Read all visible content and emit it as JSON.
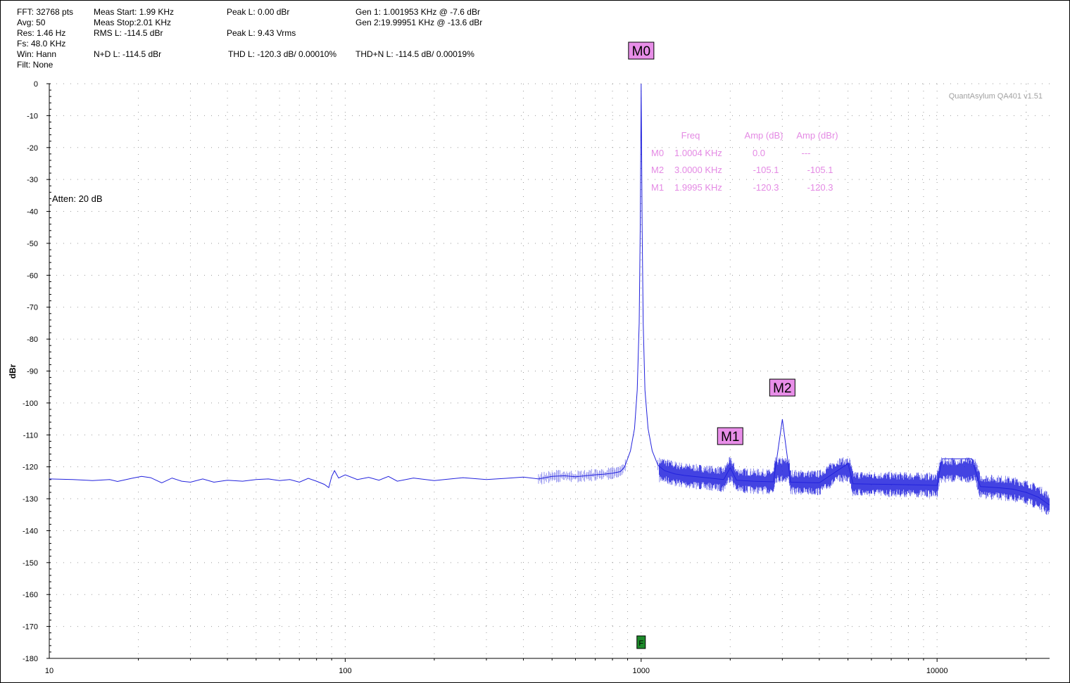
{
  "info": {
    "col1": [
      "FFT: 32768 pts",
      "Avg: 50",
      "Res: 1.46 Hz",
      "Fs: 48.0 KHz",
      "Win: Hann",
      "Filt: None"
    ],
    "meas_start": "Meas Start: 1.99 KHz",
    "meas_stop": "Meas Stop:2.01 KHz",
    "rms": "RMS L: -114.5 dBr",
    "nd": "N+D L: -114.5 dBr",
    "peak_dbr": "Peak L: 0.00 dBr",
    "peak_vrms": "Peak L: 9.43 Vrms",
    "thd": "THD L: -120.3 dB/ 0.00010%",
    "gen1": "Gen 1: 1.001953 KHz @ -7.6  dBr",
    "gen2": "Gen 2:19.99951 KHz @ -13.6  dBr",
    "thdn": "THD+N L: -114.5 dB/ 0.00019%"
  },
  "watermark": "QuantAsylum QA401 v1.51",
  "atten": "Atten: 20 dB",
  "colors": {
    "trace": "#2222dd",
    "marker_bg": "#e88ee8",
    "marker_table": "#e48ae4",
    "grid": "#9a9a9a",
    "f_marker": "#1d8a2a"
  },
  "marker_table": {
    "headers": [
      "Freq",
      "Amp (dB)",
      "Amp (dBr)"
    ],
    "rows": [
      {
        "name": "M0",
        "freq": "1.0004 KHz",
        "amp_db": "0.0",
        "amp_dbr": "---"
      },
      {
        "name": "M2",
        "freq": "3.0000 KHz",
        "amp_db": "-105.1",
        "amp_dbr": "-105.1"
      },
      {
        "name": "M1",
        "freq": "1.9995 KHz",
        "amp_db": "-120.3",
        "amp_dbr": "-120.3"
      }
    ]
  },
  "chart_data": {
    "type": "line",
    "title": "",
    "xlabel": "",
    "ylabel": "dBr",
    "x_scale": "log",
    "xlim": [
      10,
      24000
    ],
    "ylim": [
      -180,
      0
    ],
    "x_ticks": [
      10,
      100,
      1000,
      10000
    ],
    "y_ticks": [
      0,
      -10,
      -20,
      -30,
      -40,
      -50,
      -60,
      -70,
      -80,
      -90,
      -100,
      -110,
      -120,
      -130,
      -140,
      -150,
      -160,
      -170,
      -180
    ],
    "grid": true,
    "series": [
      {
        "values": [
          [
            10,
            -123.8
          ],
          [
            12,
            -124.0
          ],
          [
            14,
            -124.3
          ],
          [
            16,
            -124.0
          ],
          [
            17,
            -124.6
          ],
          [
            19,
            -123.6
          ],
          [
            20.5,
            -123.0
          ],
          [
            22,
            -123.4
          ],
          [
            24,
            -125.0
          ],
          [
            26,
            -123.5
          ],
          [
            28,
            -124.5
          ],
          [
            30,
            -124.8
          ],
          [
            33,
            -123.8
          ],
          [
            36,
            -124.8
          ],
          [
            40,
            -124.2
          ],
          [
            45,
            -124.5
          ],
          [
            50,
            -124.0
          ],
          [
            55,
            -123.8
          ],
          [
            60,
            -124.3
          ],
          [
            65,
            -124.0
          ],
          [
            70,
            -124.8
          ],
          [
            75,
            -123.6
          ],
          [
            80,
            -124.5
          ],
          [
            85,
            -125.5
          ],
          [
            88,
            -126.5
          ],
          [
            90,
            -123.0
          ],
          [
            92,
            -121.2
          ],
          [
            95,
            -123.5
          ],
          [
            100,
            -122.5
          ],
          [
            110,
            -124.0
          ],
          [
            120,
            -123.3
          ],
          [
            130,
            -124.2
          ],
          [
            140,
            -123.0
          ],
          [
            150,
            -124.5
          ],
          [
            170,
            -123.5
          ],
          [
            200,
            -124.3
          ],
          [
            250,
            -123.4
          ],
          [
            300,
            -124.0
          ],
          [
            350,
            -123.6
          ],
          [
            400,
            -123.2
          ],
          [
            450,
            -123.8
          ],
          [
            500,
            -123.0
          ],
          [
            550,
            -122.8
          ],
          [
            600,
            -123.1
          ],
          [
            650,
            -122.8
          ],
          [
            700,
            -122.5
          ],
          [
            750,
            -122.3
          ],
          [
            800,
            -122.0
          ],
          [
            850,
            -121.5
          ],
          [
            880,
            -120.0
          ],
          [
            920,
            -115.0
          ],
          [
            950,
            -108.0
          ],
          [
            970,
            -96.0
          ],
          [
            985,
            -75.0
          ],
          [
            993,
            -45.0
          ],
          [
            998,
            -15.0
          ],
          [
            1000.4,
            0.0
          ],
          [
            1003,
            -15.0
          ],
          [
            1008,
            -45.0
          ],
          [
            1016,
            -75.0
          ],
          [
            1030,
            -96.0
          ],
          [
            1055,
            -108.0
          ],
          [
            1090,
            -115.0
          ],
          [
            1140,
            -119.5
          ],
          [
            1200,
            -121.2
          ],
          [
            1300,
            -122.2
          ],
          [
            1400,
            -122.7
          ],
          [
            1500,
            -123.0
          ],
          [
            1700,
            -123.5
          ],
          [
            1900,
            -124.0
          ],
          [
            1999.5,
            -120.3
          ],
          [
            2100,
            -124.2
          ],
          [
            2400,
            -124.5
          ],
          [
            2800,
            -124.7
          ],
          [
            3000,
            -105.1
          ],
          [
            3200,
            -124.8
          ],
          [
            4000,
            -125.0
          ],
          [
            5000,
            -119.0
          ],
          [
            5200,
            -125.3
          ],
          [
            6000,
            -125.4
          ],
          [
            8000,
            -125.6
          ],
          [
            10000,
            -125.8
          ],
          [
            10400,
            -117.5
          ],
          [
            11200,
            -117.5
          ],
          [
            12300,
            -117.5
          ],
          [
            13100,
            -117.5
          ],
          [
            14000,
            -126.2
          ],
          [
            16000,
            -126.5
          ],
          [
            18000,
            -127.0
          ],
          [
            20000,
            -128.0
          ],
          [
            22000,
            -129.5
          ],
          [
            24000,
            -132.0
          ]
        ]
      }
    ],
    "markers": [
      {
        "name": "M0",
        "x": 1000.4,
        "y": 0.0
      },
      {
        "name": "M1",
        "x": 1999.5,
        "y": -120.3
      },
      {
        "name": "M2",
        "x": 3000.0,
        "y": -105.1
      }
    ],
    "annotations": [
      {
        "label": "F",
        "x": 1000
      }
    ]
  }
}
